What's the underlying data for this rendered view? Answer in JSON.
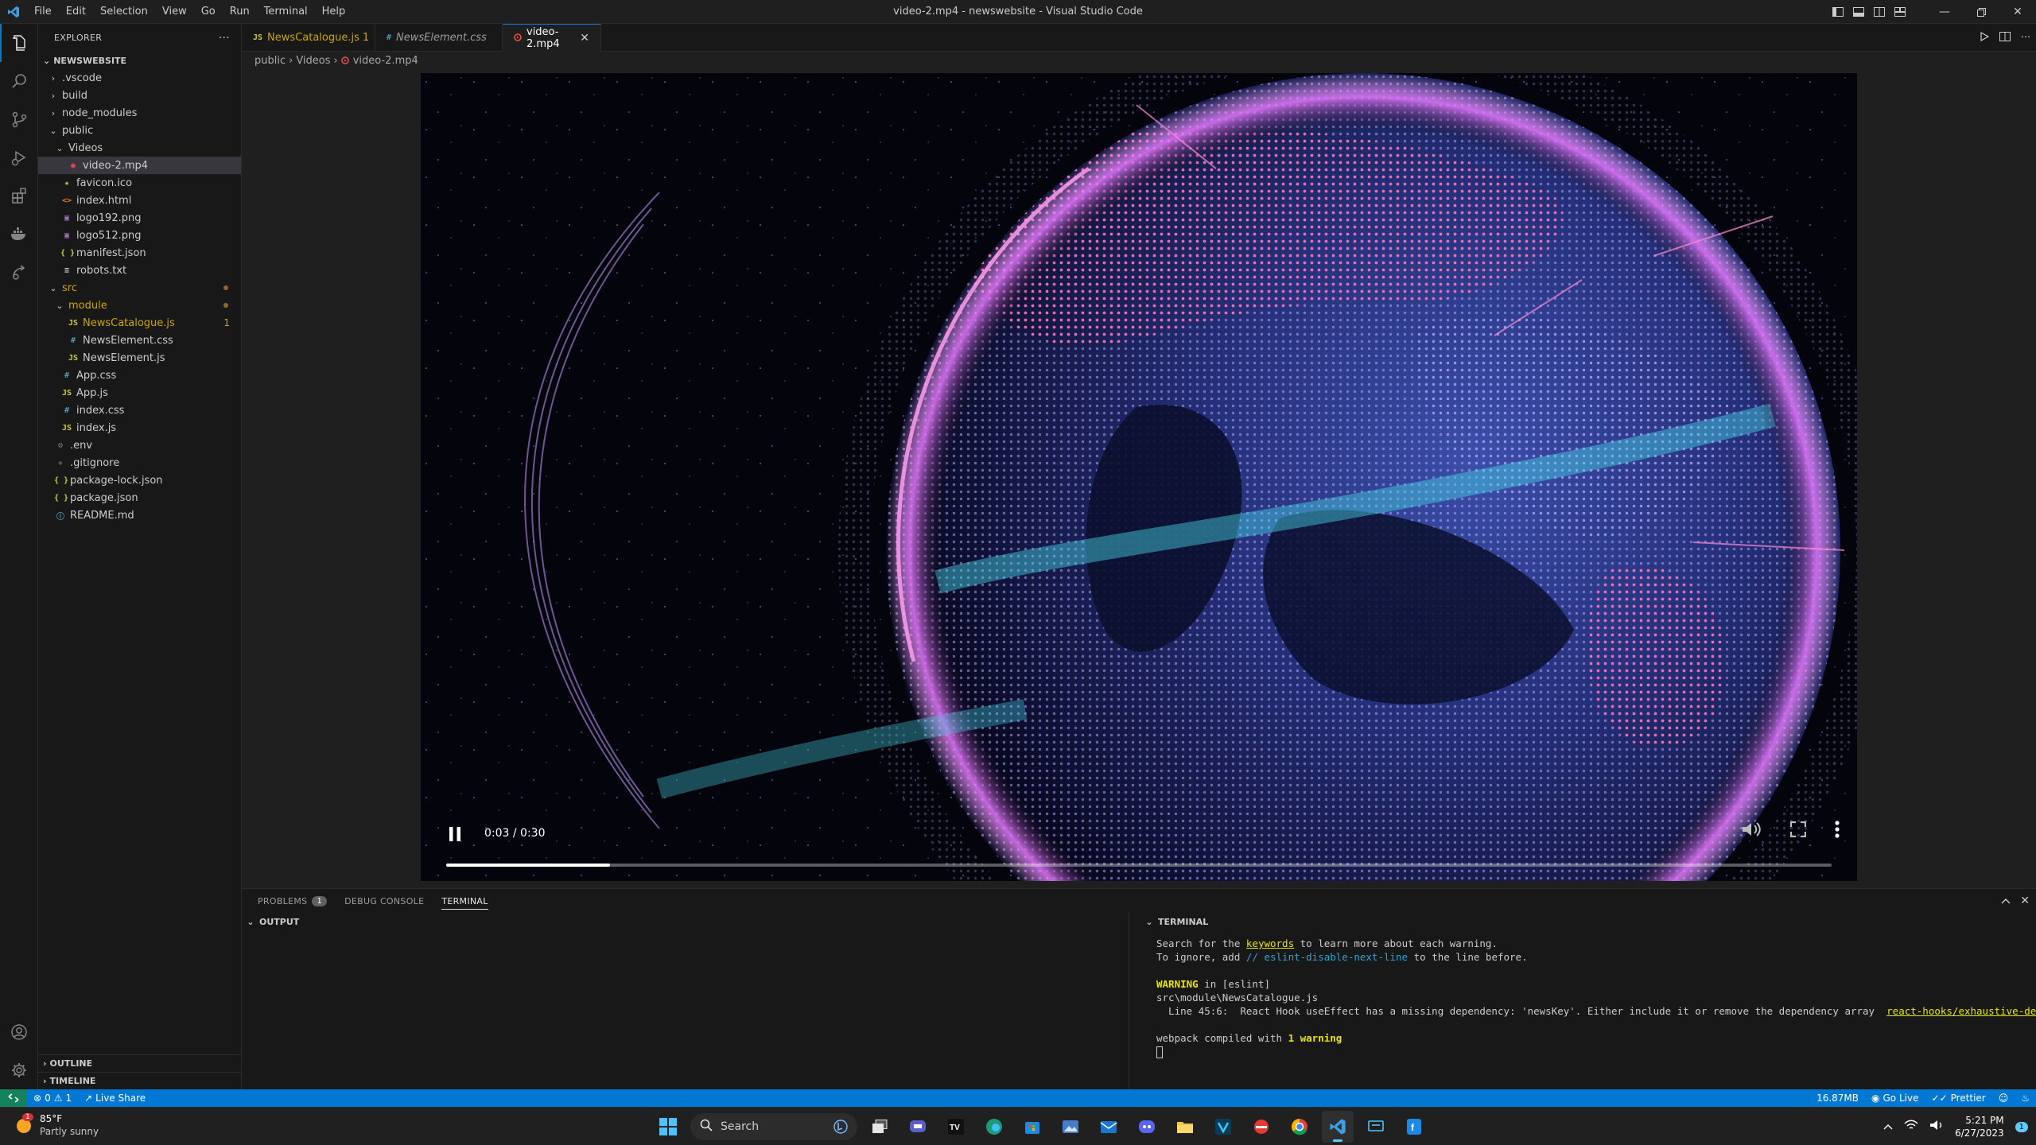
{
  "window": {
    "title": "video-2.mp4 - newswebsite - Visual Studio Code",
    "menu": [
      "File",
      "Edit",
      "Selection",
      "View",
      "Go",
      "Run",
      "Terminal",
      "Help"
    ]
  },
  "sidebar": {
    "header": "EXPLORER",
    "more": "···",
    "project": "NEWSWEBSITE",
    "tree": [
      {
        "label": ".vscode",
        "type": "folder",
        "open": false,
        "depth": 0
      },
      {
        "label": "build",
        "type": "folder",
        "open": false,
        "depth": 0
      },
      {
        "label": "node_modules",
        "type": "folder",
        "open": false,
        "depth": 0
      },
      {
        "label": "public",
        "type": "folder",
        "open": true,
        "depth": 0
      },
      {
        "label": "Videos",
        "type": "folder",
        "open": true,
        "depth": 1
      },
      {
        "label": "video-2.mp4",
        "type": "video",
        "depth": 2,
        "selected": true
      },
      {
        "label": "favicon.ico",
        "type": "star",
        "depth": 1
      },
      {
        "label": "index.html",
        "type": "html",
        "depth": 1
      },
      {
        "label": "logo192.png",
        "type": "img",
        "depth": 1
      },
      {
        "label": "logo512.png",
        "type": "img",
        "depth": 1
      },
      {
        "label": "manifest.json",
        "type": "json",
        "depth": 1
      },
      {
        "label": "robots.txt",
        "type": "txt",
        "depth": 1
      },
      {
        "label": "src",
        "type": "folder",
        "open": true,
        "depth": 0,
        "modified": true
      },
      {
        "label": "module",
        "type": "folder",
        "open": true,
        "depth": 1,
        "modified": true
      },
      {
        "label": "NewsCatalogue.js",
        "type": "js",
        "depth": 2,
        "warning": true,
        "badge": "1"
      },
      {
        "label": "NewsElement.css",
        "type": "css",
        "depth": 2
      },
      {
        "label": "NewsElement.js",
        "type": "js",
        "depth": 2
      },
      {
        "label": "App.css",
        "type": "css",
        "depth": 1
      },
      {
        "label": "App.js",
        "type": "js",
        "depth": 1
      },
      {
        "label": "index.css",
        "type": "css",
        "depth": 1
      },
      {
        "label": "index.js",
        "type": "js",
        "depth": 1
      },
      {
        "label": ".env",
        "type": "gear",
        "depth": 0
      },
      {
        "label": ".gitignore",
        "type": "git",
        "depth": 0
      },
      {
        "label": "package-lock.json",
        "type": "json",
        "depth": 0
      },
      {
        "label": "package.json",
        "type": "json",
        "depth": 0
      },
      {
        "label": "README.md",
        "type": "info",
        "depth": 0
      }
    ],
    "outline": "OUTLINE",
    "timeline": "TIMELINE"
  },
  "tabs": [
    {
      "label": "NewsCatalogue.js",
      "icon": "JS",
      "suffix": "1",
      "style": "warning"
    },
    {
      "label": "NewsElement.css",
      "icon": "#",
      "suffix": "",
      "style": "italic"
    },
    {
      "label": "video-2.mp4",
      "icon": "video",
      "suffix": "",
      "style": "active"
    }
  ],
  "breadcrumb": [
    "public",
    "Videos",
    "video-2.mp4"
  ],
  "video": {
    "time": "0:03 / 0:30",
    "progress": 0.118
  },
  "panel": {
    "tabs": [
      {
        "label": "PROBLEMS",
        "badge": "1"
      },
      {
        "label": "DEBUG CONSOLE",
        "badge": ""
      },
      {
        "label": "TERMINAL",
        "badge": ""
      }
    ],
    "output_title": "OUTPUT",
    "terminal_title": "TERMINAL",
    "terminal": {
      "l1_pre": "Search for the ",
      "l1_link": "keywords",
      "l1_post": " to learn more about each warning.",
      "l2_pre": "To ignore, add ",
      "l2_code": "// eslint-disable-next-line",
      "l2_post": " to the line before.",
      "l3_warn": "WARNING",
      "l3_post": " in [eslint]",
      "l4": "src\\module\\NewsCatalogue.js",
      "l5": "  Line 45:6:  React Hook useEffect has a missing dependency: 'newsKey'. Either include it or remove the dependency array  ",
      "l5_link": "react-hooks/exhaustive-deps",
      "l6_pre": "webpack compiled with ",
      "l6_warn": "1 warning"
    }
  },
  "statusbar": {
    "errors": "0",
    "warnings": "1",
    "live_share": "Live Share",
    "memory": "16.87MB",
    "go_live": "Go Live",
    "prettier": "Prettier"
  },
  "taskbar": {
    "weather_temp": "85°F",
    "weather_desc": "Partly sunny",
    "weather_badge": "1",
    "search_placeholder": "Search",
    "time": "5:21 PM",
    "date": "6/27/2023",
    "notif": "1"
  },
  "colors": {
    "accent": "#0078d4",
    "js": "#cbcb41",
    "css": "#519aba",
    "json": "#cbcb41",
    "html": "#e37933",
    "video": "#f14c4c",
    "warning": "#cca700"
  }
}
